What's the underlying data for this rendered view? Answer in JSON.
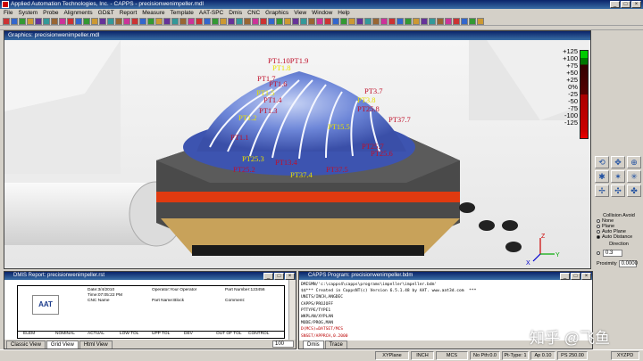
{
  "app_title": "Applied Automation Technologies, Inc. - CAPPS - precisionwenimpeller.mdl",
  "menu": [
    "File",
    "System",
    "Probe",
    "Alignments",
    "GD&T",
    "Report",
    "Measure",
    "Template",
    "AAT-SPC",
    "Dmis",
    "CNC",
    "Graphics",
    "View",
    "Window",
    "Help"
  ],
  "graphics_window": {
    "title": "Graphics: precisionwenimpeller.mdl",
    "point_labels": [
      {
        "t": "PT1.10PT1.9"
      },
      {
        "t": "PT1.8"
      },
      {
        "t": "PT1.7"
      },
      {
        "t": "PT1.6"
      },
      {
        "t": "PT1.5"
      },
      {
        "t": "PT1.4"
      },
      {
        "t": "PT1.3"
      },
      {
        "t": "PT1.2"
      },
      {
        "t": "PT1.1"
      },
      {
        "t": "PT3.7"
      },
      {
        "t": "PT3.8"
      },
      {
        "t": "PT25.8"
      },
      {
        "t": "PT37.7"
      },
      {
        "t": "PT15.5"
      },
      {
        "t": "PT25.7"
      },
      {
        "t": "PT25.6"
      },
      {
        "t": "PT37.4"
      },
      {
        "t": "PT37.5"
      },
      {
        "t": "PT13.4"
      },
      {
        "t": "PT25.3"
      },
      {
        "t": "PT25.2"
      }
    ],
    "axis": {
      "x": "X",
      "y": "Y",
      "z": "Z"
    }
  },
  "color_scale": [
    "+125",
    "+100",
    "+75",
    "+50",
    "+25",
    "0%",
    "-25",
    "-50",
    "-75",
    "-100",
    "-125"
  ],
  "collision": {
    "title": "Collision Avoid",
    "options": [
      "None",
      "Plane",
      "Auto Plane",
      "Auto Distance"
    ],
    "selected": "Auto Distance",
    "direction_label": "Direction",
    "distance_value": "0.3",
    "proximity_label": "Proximity",
    "proximity_value": "0.0000"
  },
  "report": {
    "title": "DMIS Report: precisionwenimpeller.rst",
    "date": "Date:3/4/2010",
    "time": "Time:07:05:22 PM",
    "cnc": "CNC Name",
    "operator": "Operator:Your Operator",
    "part_number": "Part Number:123456",
    "part_name": "Part Name:Block",
    "comment": "Comment:",
    "logo": "AAT",
    "columns": [
      "ELEM",
      "NOMINAL",
      "ACTUAL",
      "LOW TOL",
      "UPP TOL",
      "DEV",
      "OUT OF TOL",
      "CONTROL"
    ],
    "tabs": [
      "Classic View",
      "Grid View",
      "Html View"
    ],
    "active_tab": "Grid View",
    "zoom": "100"
  },
  "program": {
    "title": "CAPPS Program: precisionwenimpeller.bdm",
    "lines": [
      "DMISMN/'c:\\capps4\\capps\\programs\\impeller\\impeller.bdm'",
      "$$*** Created in CappsNT(c) Version 6.5.1.48 by AAT. www.aat3d.com  ***",
      "UNITS/INCH,ANGDEC",
      "CAPPS/PROJOFF",
      "PTTYPE/TYPE1",
      "WKPLAN/XYPLAN",
      "MODE/PROG,MAN",
      "D(MCS)=DATSET/MCS",
      "SNSET/APPRCH,0.2000"
    ],
    "highlight_from": 7,
    "tabs": [
      "Dmis",
      "Trace"
    ]
  },
  "status": [
    "XYPlane",
    "INCH",
    "MCS",
    "No Pth:0.0",
    "Pt-Type: 1",
    "Ap 0.10",
    "PS 250.00",
    "XYZPD"
  ],
  "watermark": "知乎 @飞鱼"
}
